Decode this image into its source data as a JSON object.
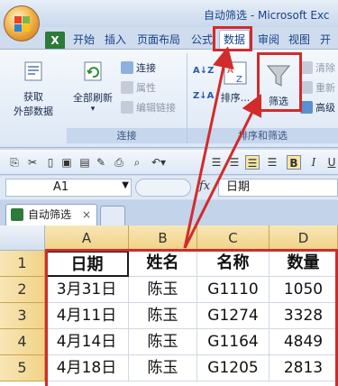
{
  "title": "自动筛选 - Microsoft Exc",
  "tabs": [
    {
      "label": "开始"
    },
    {
      "label": "插入"
    },
    {
      "label": "页面布局"
    },
    {
      "label": "公式"
    },
    {
      "label": "数据"
    },
    {
      "label": "审阅"
    },
    {
      "label": "视图"
    },
    {
      "label": "开发"
    }
  ],
  "ribbon": {
    "get_external_data": "获取\n外部数据",
    "refresh_all": "全部刷新",
    "connections": "连接",
    "properties": "属性",
    "edit_links": "编辑链接",
    "connections_group": "连接",
    "sort": "排序...",
    "filter": "筛选",
    "clear": "清除",
    "reapply": "重新",
    "advanced": "高级",
    "sort_filter_group": "排序和筛选"
  },
  "formula_bar": {
    "name_box": "A1",
    "fx": "fx",
    "formula": "日期"
  },
  "sheet_tab": {
    "label": "自动筛选"
  },
  "grid": {
    "columns": [
      "A",
      "B",
      "C",
      "D"
    ],
    "rows": [
      "1",
      "2",
      "3",
      "4",
      "5"
    ],
    "cells": [
      [
        "日期",
        "姓名",
        "名称",
        "数量"
      ],
      [
        "3月31日",
        "陈玉",
        "G1110",
        "1050"
      ],
      [
        "4月11日",
        "陈玉",
        "G1274",
        "3328"
      ],
      [
        "4月14日",
        "陈玉",
        "G1164",
        "4849"
      ],
      [
        "4月18日",
        "陈玉",
        "G1205",
        "2813"
      ]
    ]
  },
  "colors": {
    "annotation": "#d22b2b",
    "header_fill": "#f2d387"
  }
}
